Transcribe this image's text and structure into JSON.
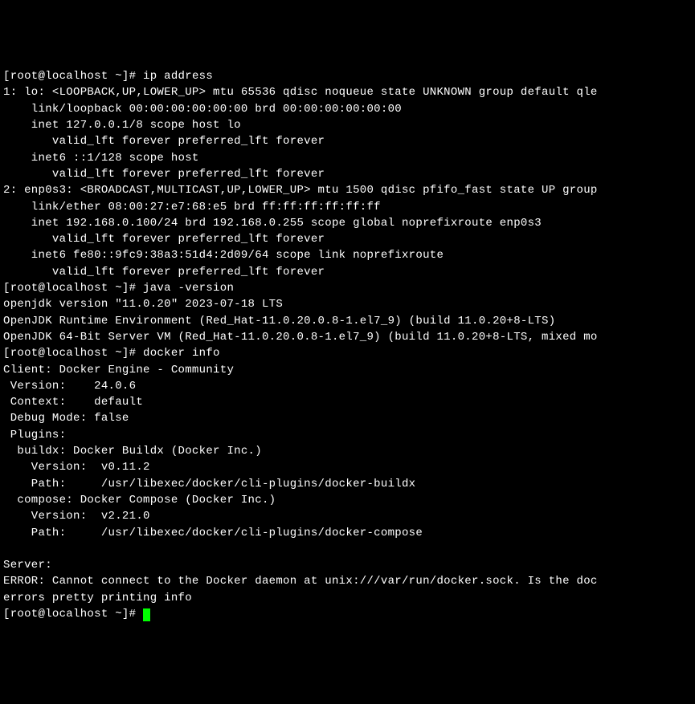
{
  "prompt": "[root@localhost ~]# ",
  "commands": {
    "ip": "ip address",
    "java": "java -version",
    "docker": "docker info"
  },
  "output": {
    "ip": {
      "lo_header": "1: lo: <LOOPBACK,UP,LOWER_UP> mtu 65536 qdisc noqueue state UNKNOWN group default qle",
      "lo_link": "    link/loopback 00:00:00:00:00:00 brd 00:00:00:00:00:00",
      "lo_inet": "    inet 127.0.0.1/8 scope host lo",
      "lo_valid1": "       valid_lft forever preferred_lft forever",
      "lo_inet6": "    inet6 ::1/128 scope host",
      "lo_valid2": "       valid_lft forever preferred_lft forever",
      "enp_header": "2: enp0s3: <BROADCAST,MULTICAST,UP,LOWER_UP> mtu 1500 qdisc pfifo_fast state UP group",
      "enp_link": "    link/ether 08:00:27:e7:68:e5 brd ff:ff:ff:ff:ff:ff",
      "enp_inet": "    inet 192.168.0.100/24 brd 192.168.0.255 scope global noprefixroute enp0s3",
      "enp_valid1": "       valid_lft forever preferred_lft forever",
      "enp_inet6": "    inet6 fe80::9fc9:38a3:51d4:2d09/64 scope link noprefixroute",
      "enp_valid2": "       valid_lft forever preferred_lft forever"
    },
    "java": {
      "l1": "openjdk version \"11.0.20\" 2023-07-18 LTS",
      "l2": "OpenJDK Runtime Environment (Red_Hat-11.0.20.0.8-1.el7_9) (build 11.0.20+8-LTS)",
      "l3": "OpenJDK 64-Bit Server VM (Red_Hat-11.0.20.0.8-1.el7_9) (build 11.0.20+8-LTS, mixed mo"
    },
    "docker": {
      "client_header": "Client: Docker Engine - Community",
      "version": " Version:    24.0.6",
      "context": " Context:    default",
      "debug": " Debug Mode: false",
      "plugins": " Plugins:",
      "buildx_header": "  buildx: Docker Buildx (Docker Inc.)",
      "buildx_version": "    Version:  v0.11.2",
      "buildx_path": "    Path:     /usr/libexec/docker/cli-plugins/docker-buildx",
      "compose_header": "  compose: Docker Compose (Docker Inc.)",
      "compose_version": "    Version:  v2.21.0",
      "compose_path": "    Path:     /usr/libexec/docker/cli-plugins/docker-compose",
      "blank": "",
      "server_header": "Server:",
      "error": "ERROR: Cannot connect to the Docker daemon at unix:///var/run/docker.sock. Is the doc",
      "errors_line": "errors pretty printing info"
    }
  }
}
